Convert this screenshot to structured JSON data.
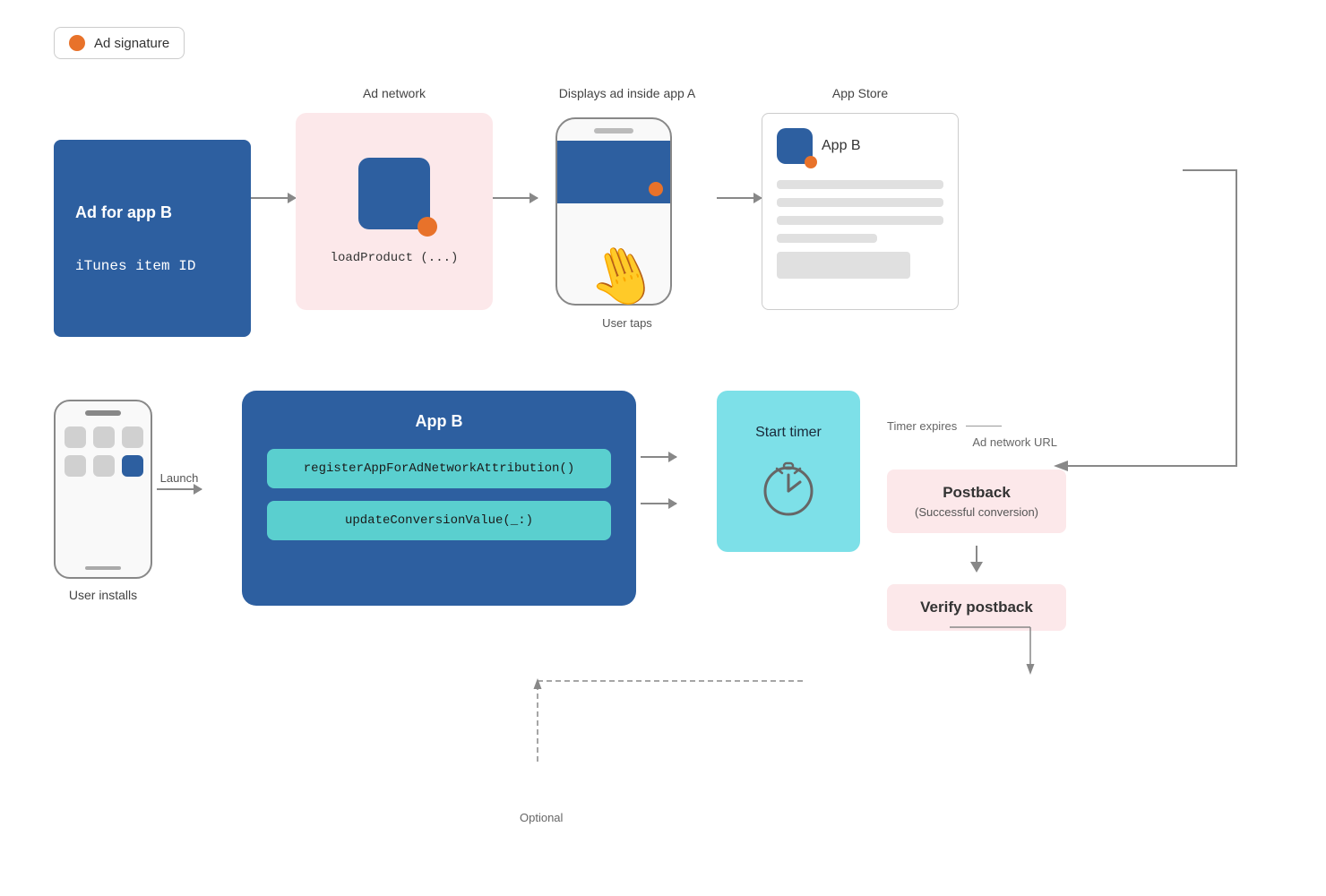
{
  "legend": {
    "dot_color": "#e8722a",
    "label": "Ad signature"
  },
  "top_row": {
    "box1": {
      "label": "",
      "title": "Ad for app B",
      "subtitle": "iTunes item ID"
    },
    "box2": {
      "label": "Ad network",
      "code": "loadProduct (...)"
    },
    "box3": {
      "label": "Displays ad inside app A",
      "user_taps": "User taps"
    },
    "box4": {
      "label": "App Store",
      "app_name": "App B"
    }
  },
  "bottom_row": {
    "phone": {
      "label": "User installs",
      "launch_label": "Launch"
    },
    "appb": {
      "title": "App B",
      "func1": "registerAppForAdNetworkAttribution()",
      "func2": "updateConversionValue(_:)"
    },
    "timer": {
      "label": "Start timer"
    },
    "timer_expires": "Timer expires",
    "optional": "Optional",
    "ad_network_url": "Ad network URL",
    "postback": {
      "title": "Postback",
      "subtitle": "(Successful conversion)"
    },
    "verify": {
      "title": "Verify postback"
    }
  }
}
